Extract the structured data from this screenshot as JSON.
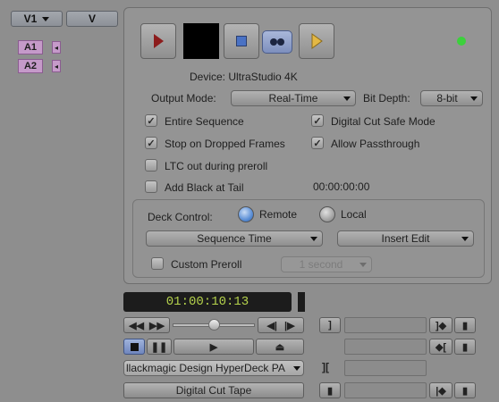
{
  "tracks": {
    "v1_label": "V1",
    "v_label": "V",
    "a1_label": "A1",
    "a2_label": "A2"
  },
  "status_color": "#3cd13c",
  "device_label": "Device: UltraStudio 4K",
  "output_mode": {
    "label": "Output Mode:",
    "value": "Real-Time"
  },
  "bit_depth": {
    "label": "Bit Depth:",
    "value": "8-bit"
  },
  "options": {
    "entire_sequence": "Entire Sequence",
    "digital_cut_safe_mode": "Digital Cut Safe Mode",
    "stop_on_dropped_frames": "Stop on Dropped Frames",
    "allow_passthrough": "Allow Passthrough",
    "ltc_out_preroll": "LTC out during preroll",
    "add_black_tail": "Add Black at Tail"
  },
  "tail_timecode": "00:00:00:00",
  "deck_control": {
    "label": "Deck Control:",
    "remote": "Remote",
    "local": "Local",
    "time_mode": "Sequence Time",
    "edit_mode": "Insert Edit",
    "custom_preroll": "Custom Preroll",
    "preroll_value": "1 second"
  },
  "timecode": "01:00:10:13",
  "deck_name": "llackmagic Design HyperDeck PA",
  "digital_cut_button": "Digital Cut Tape"
}
